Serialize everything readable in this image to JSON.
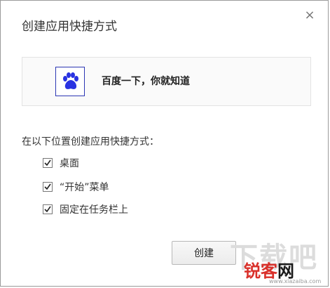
{
  "dialog": {
    "title": "创建应用快捷方式",
    "close_glyph": "×"
  },
  "app": {
    "icon": "baidu-paw-icon",
    "name": "百度一下，你就知道",
    "icon_color": "#2932e1"
  },
  "section_label": "在以下位置创建应用快捷方式：",
  "options": [
    {
      "label": "桌面",
      "checked": true
    },
    {
      "label": "“开始”菜单",
      "checked": true
    },
    {
      "label": "固定在任务栏上",
      "checked": true
    }
  ],
  "buttons": {
    "create_label": "创建"
  },
  "watermark": {
    "top_text": "下载吧",
    "brand_red": "锐客",
    "brand_black": "网",
    "url": "www.xiazaiba.com"
  }
}
